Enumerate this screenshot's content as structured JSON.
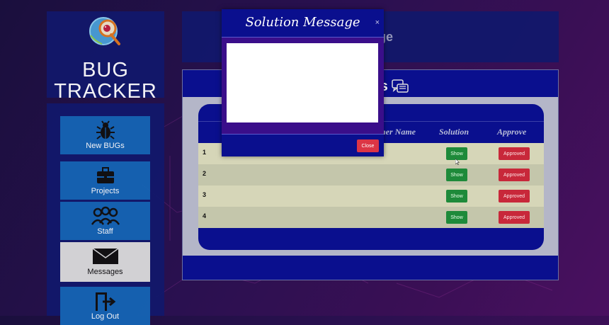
{
  "brand": {
    "line1": "BUG",
    "line2": "TRACKER"
  },
  "header": {
    "title_partial": "in Page"
  },
  "sidebar": {
    "items": [
      {
        "label": "New BUGs",
        "icon": "bug-icon"
      },
      {
        "label": "Projects",
        "icon": "briefcase-icon"
      },
      {
        "label": "Staff",
        "icon": "users-icon"
      },
      {
        "label": "Messages",
        "icon": "envelope-icon",
        "active": true
      },
      {
        "label": "Log Out",
        "icon": "logout-icon"
      }
    ]
  },
  "content": {
    "title_partial": "essages",
    "title_icon": "chat-icon",
    "table": {
      "columns": [
        "ner Name",
        "Solution",
        "Approve"
      ],
      "rows": [
        {
          "num": "1",
          "solution": "Show",
          "approve": "Approved"
        },
        {
          "num": "2",
          "solution": "Show",
          "approve": "Approved"
        },
        {
          "num": "3",
          "solution": "Show",
          "approve": "Approved"
        },
        {
          "num": "4",
          "solution": "Show",
          "approve": "Approved"
        }
      ]
    }
  },
  "modal": {
    "title": "Solution Message",
    "close_symbol": "×",
    "body_text": "",
    "close_button": "Close"
  },
  "colors": {
    "panel": "#12186b",
    "navy": "#0a0f8e",
    "nav_blue": "#1565b5",
    "show_green": "#1e8a3a",
    "approved_red": "#c8283a",
    "modal_body": "#3a0e8a"
  }
}
